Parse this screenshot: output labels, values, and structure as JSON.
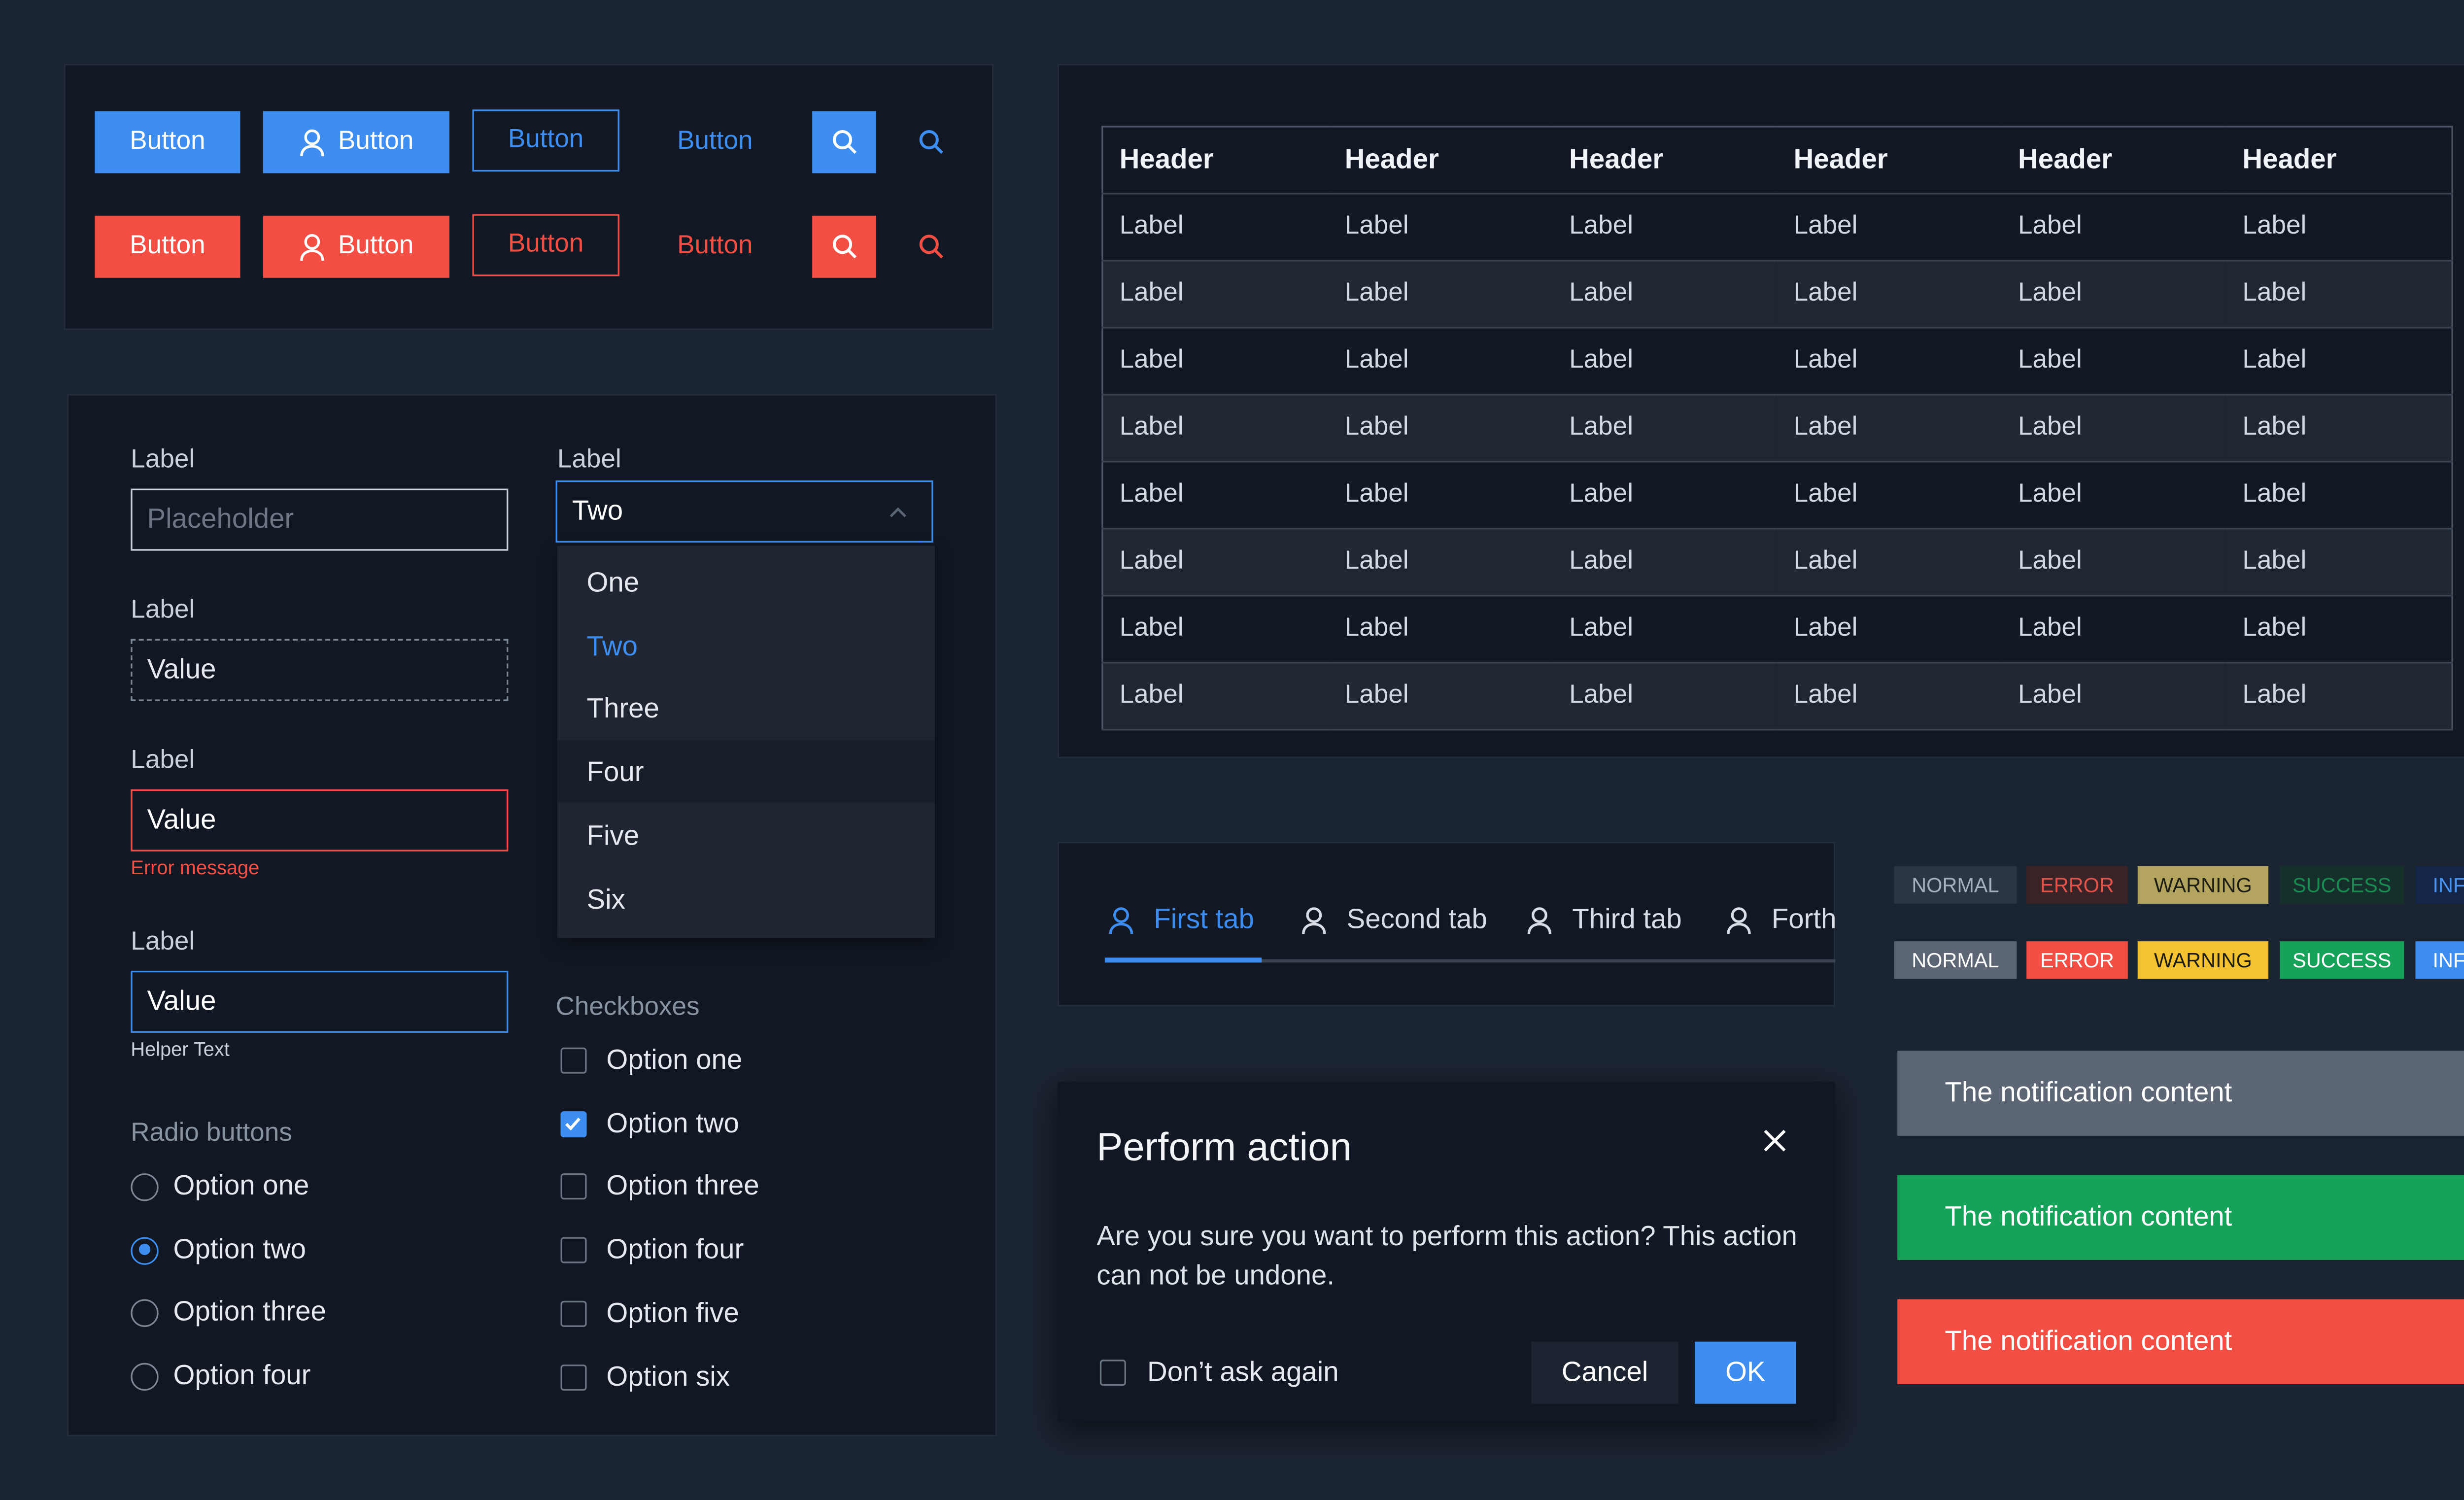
{
  "colors": {
    "primary": "#3d8ef0",
    "danger": "#f24e43",
    "bg": "#1b2431",
    "panel": "#111823"
  },
  "buttons": {
    "blue": {
      "solid": "Button",
      "icon_solid": "Button",
      "outline": "Button",
      "ghost": "Button",
      "icon_only": "search-icon"
    },
    "red": {
      "solid": "Button",
      "icon_solid": "Button",
      "outline": "Button",
      "ghost": "Button",
      "icon_only": "search-icon"
    }
  },
  "form": {
    "text_field": {
      "label": "Label",
      "placeholder": "Placeholder"
    },
    "readonly_field": {
      "label": "Label",
      "value": "Value"
    },
    "error_field": {
      "label": "Label",
      "value": "Value",
      "error": "Error message"
    },
    "focus_field": {
      "label": "Label",
      "value": "Value",
      "helper": "Helper Text"
    },
    "select": {
      "label": "Label",
      "value": "Two",
      "options": [
        "One",
        "Two",
        "Three",
        "Four",
        "Five",
        "Six"
      ]
    },
    "radios": {
      "title": "Radio buttons",
      "options": [
        "Option one",
        "Option two",
        "Option three",
        "Option four"
      ],
      "selected": "Option two"
    },
    "checkboxes": {
      "title": "Checkboxes",
      "options": [
        "Option one",
        "Option two",
        "Option three",
        "Option four",
        "Option five",
        "Option six"
      ],
      "checked": [
        "Option two"
      ]
    }
  },
  "table": {
    "headers": [
      "Header",
      "Header",
      "Header",
      "Header",
      "Header",
      "Header"
    ],
    "rows": [
      [
        "Label",
        "Label",
        "Label",
        "Label",
        "Label",
        "Label"
      ],
      [
        "Label",
        "Label",
        "Label",
        "Label",
        "Label",
        "Label"
      ],
      [
        "Label",
        "Label",
        "Label",
        "Label",
        "Label",
        "Label"
      ],
      [
        "Label",
        "Label",
        "Label",
        "Label",
        "Label",
        "Label"
      ],
      [
        "Label",
        "Label",
        "Label",
        "Label",
        "Label",
        "Label"
      ],
      [
        "Label",
        "Label",
        "Label",
        "Label",
        "Label",
        "Label"
      ],
      [
        "Label",
        "Label",
        "Label",
        "Label",
        "Label",
        "Label"
      ],
      [
        "Label",
        "Label",
        "Label",
        "Label",
        "Label",
        "Label"
      ]
    ]
  },
  "tabs": {
    "items": [
      "First tab",
      "Second tab",
      "Third tab",
      "Forth"
    ],
    "active": "First tab"
  },
  "tags": {
    "subtle": [
      "NORMAL",
      "ERROR",
      "WARNING",
      "SUCCESS",
      "INFO"
    ],
    "solid": [
      "NORMAL",
      "ERROR",
      "WARNING",
      "SUCCESS",
      "INFO"
    ]
  },
  "dialog": {
    "title": "Perform action",
    "body": "Are you sure you want to perform this action? This action can not be undone.",
    "checkbox": "Don’t ask again",
    "cancel": "Cancel",
    "ok": "OK"
  },
  "notifications": [
    {
      "text": "The notification content",
      "color": "#5c6675"
    },
    {
      "text": "The notification content",
      "color": "#17a25a"
    },
    {
      "text": "The notification content",
      "color": "#f24e43"
    }
  ]
}
